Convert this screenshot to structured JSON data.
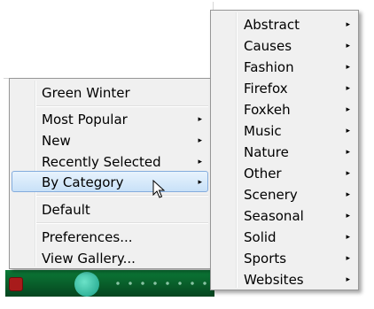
{
  "main_menu": {
    "items": [
      {
        "label": "Green Winter",
        "arrow": ""
      },
      {
        "label": "Most Popular",
        "arrow": "▸"
      },
      {
        "label": "New",
        "arrow": "▸"
      },
      {
        "label": "Recently Selected",
        "arrow": "▸"
      },
      {
        "label": "By Category",
        "arrow": "▸"
      },
      {
        "label": "Default",
        "arrow": ""
      },
      {
        "label": "Preferences...",
        "arrow": ""
      },
      {
        "label": "View Gallery...",
        "arrow": ""
      }
    ],
    "selected_item": "By Category"
  },
  "category_menu": {
    "items": [
      {
        "label": "Abstract",
        "arrow": "▸"
      },
      {
        "label": "Causes",
        "arrow": "▸"
      },
      {
        "label": "Fashion",
        "arrow": "▸"
      },
      {
        "label": "Firefox",
        "arrow": "▸"
      },
      {
        "label": "Foxkeh",
        "arrow": "▸"
      },
      {
        "label": "Music",
        "arrow": "▸"
      },
      {
        "label": "Nature",
        "arrow": "▸"
      },
      {
        "label": "Other",
        "arrow": "▸"
      },
      {
        "label": "Scenery",
        "arrow": "▸"
      },
      {
        "label": "Seasonal",
        "arrow": "▸"
      },
      {
        "label": "Solid",
        "arrow": "▸"
      },
      {
        "label": "Sports",
        "arrow": "▸"
      },
      {
        "label": "Websites",
        "arrow": "▸"
      }
    ]
  },
  "colors": {
    "menu_bg": "#f0f0f0",
    "highlight_border": "#84acdd",
    "status_strip": "#0c7a37"
  },
  "icons": {
    "cursor": "mouse-pointer-icon",
    "submenu": "submenu-arrow-icon",
    "status_icon": "fox-icon"
  }
}
